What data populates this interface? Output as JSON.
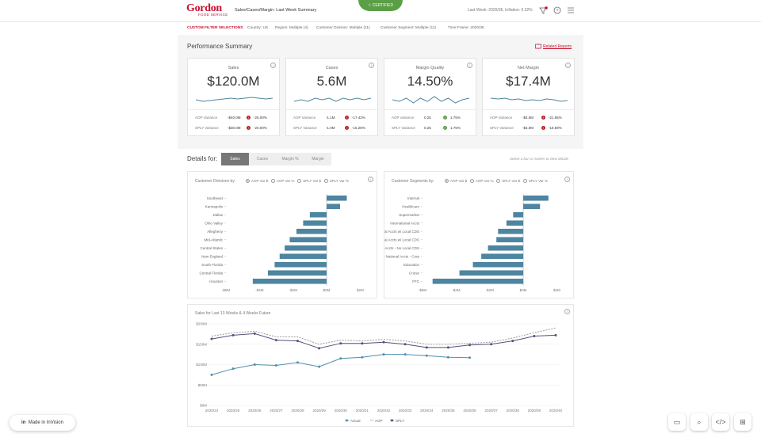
{
  "header": {
    "logo_main": "Gordon",
    "logo_sub": "FOOD SERVICE",
    "title": "Sales/Cases/Margin: Last Week Summary",
    "certified": "CERTIFIED",
    "last_week": "Last Week: 2020/36, Inflation: 0.32%"
  },
  "filters": {
    "label": "CUSTOM FILTER SELECTIONS",
    "country": "Country: US",
    "region": "Region: Multiple (4)",
    "division": "Customer Division: Multiple (11)",
    "segment": "Customer Segment: Multiple (11)",
    "timeframe": "Time Frame: 2020/36"
  },
  "summary": {
    "title": "Performance Summary",
    "related": "Related Reports",
    "cards": [
      {
        "title": "Sales",
        "value": "$120.0M",
        "aop_label": "AOP Variance",
        "aop_amt": "-$40.0M",
        "aop_pct": "-25.00%",
        "aop_status": "neg",
        "sply_label": "SPLY Variance",
        "sply_amt": "-$30.0M",
        "sply_pct": "-20.00%",
        "sply_status": "neg"
      },
      {
        "title": "Cases",
        "value": "5.6M",
        "aop_label": "AOP Variance",
        "aop_amt": "-1.1M",
        "aop_pct": "-17.42%",
        "aop_status": "neg",
        "sply_label": "SPLY Variance",
        "sply_amt": "-1.0M",
        "sply_pct": "-15.26%",
        "sply_status": "neg"
      },
      {
        "title": "Margin Quality",
        "value": "14.50%",
        "aop_label": "AOP Variance",
        "aop_amt": "0.25",
        "aop_pct": "1.75%",
        "aop_status": "pos",
        "sply_label": "SPLY Variance",
        "sply_amt": "0.25",
        "sply_pct": "1.75%",
        "sply_status": "pos"
      },
      {
        "title": "Net Margin",
        "value": "$17.4M",
        "aop_label": "AOP Variance",
        "aop_amt": "-$4.5M",
        "aop_pct": "-21.55%",
        "aop_status": "neg",
        "sply_label": "SPLY Variance",
        "sply_amt": "-$4.0M",
        "sply_pct": "-18.69%",
        "sply_status": "neg"
      }
    ]
  },
  "details": {
    "title": "Details for:",
    "tabs": [
      "Sales",
      "Cases",
      "Margin %",
      "Margin"
    ],
    "active_tab": "Sales",
    "hint": "Select a bar or marker to view details"
  },
  "division_chart": {
    "title": "Customer Divisions by:",
    "options": [
      "AOP Var $",
      "AOP Var %",
      "SPLY Var $",
      "SPLY Var %"
    ],
    "selected": "AOP Var $"
  },
  "segment_chart": {
    "title": "Customer Segments by:",
    "options": [
      "AOP Var $",
      "AOP Var %",
      "SPLY Var $",
      "SPLY Var %"
    ],
    "selected": "AOP Var $"
  },
  "line_chart": {
    "title": "Sales for Last 13 Weeks & 4 Weeks Future",
    "legend": [
      "Actual",
      "AOP",
      "SPLY"
    ]
  },
  "chart_data": [
    {
      "type": "bar",
      "orientation": "horizontal",
      "categories": [
        "Southeast",
        "Kannapolis",
        "Dallas",
        "Ohio Valley",
        "Allegheny",
        "Mid-Atlantic",
        "Central States",
        "New England",
        "South Florida",
        "Central Florida",
        "Houston"
      ],
      "values": [
        1.2,
        0.8,
        -1.0,
        -1.4,
        -1.8,
        -2.2,
        -2.5,
        -2.8,
        -3.1,
        -3.5,
        -4.4
      ],
      "xticks": [
        "-$6M",
        "-$4M",
        "-$2M",
        "$0M",
        "$2M"
      ],
      "xlim": [
        -6,
        2.5
      ],
      "color": "#4e85a0"
    },
    {
      "type": "bar",
      "orientation": "horizontal",
      "categories": [
        "Internal",
        "Healthcare",
        "Supermarket",
        "International Accts",
        "National Accts w/ Local CDS",
        "Regional Accts w/ Local CDS",
        "Regional Accts - No Local CDS",
        "US National Accts - Corp",
        "Education",
        "Cruise",
        "FFC"
      ],
      "values": [
        1.5,
        1.0,
        -0.6,
        -1.0,
        -1.5,
        -1.6,
        -2.1,
        -2.5,
        -3.0,
        -3.8,
        -5.4
      ],
      "xticks": [
        "-$6M",
        "-$4M",
        "-$2M",
        "$0M",
        "$2M"
      ],
      "xlim": [
        -6,
        2.5
      ],
      "color": "#4e85a0"
    },
    {
      "type": "line",
      "x": [
        "2020/24",
        "2020/25",
        "2020/26",
        "2020/27",
        "2020/28",
        "2020/29",
        "2020/30",
        "2020/31",
        "2020/32",
        "2020/33",
        "2020/34",
        "2020/35",
        "2020/36",
        "2020/37",
        "2020/38",
        "2020/39",
        "2020/40"
      ],
      "yticks": [
        "$0M",
        "$50M",
        "$100M",
        "$150M",
        "$200M"
      ],
      "ylim": [
        0,
        200
      ],
      "series": [
        {
          "name": "Actual",
          "values": [
            75,
            90,
            100,
            98,
            105,
            95,
            115,
            118,
            125,
            125,
            122,
            118,
            117,
            null,
            null,
            null,
            null
          ],
          "color": "#4e8fae"
        },
        {
          "name": "AOP",
          "values": [
            170,
            178,
            182,
            168,
            168,
            150,
            160,
            158,
            162,
            158,
            150,
            150,
            152,
            155,
            165,
            178,
            190
          ],
          "color": "#999"
        },
        {
          "name": "SPLY",
          "values": [
            163,
            172,
            176,
            160,
            158,
            140,
            152,
            152,
            155,
            150,
            142,
            142,
            148,
            150,
            158,
            170,
            172
          ],
          "color": "#5a4e7a"
        }
      ]
    }
  ]
}
